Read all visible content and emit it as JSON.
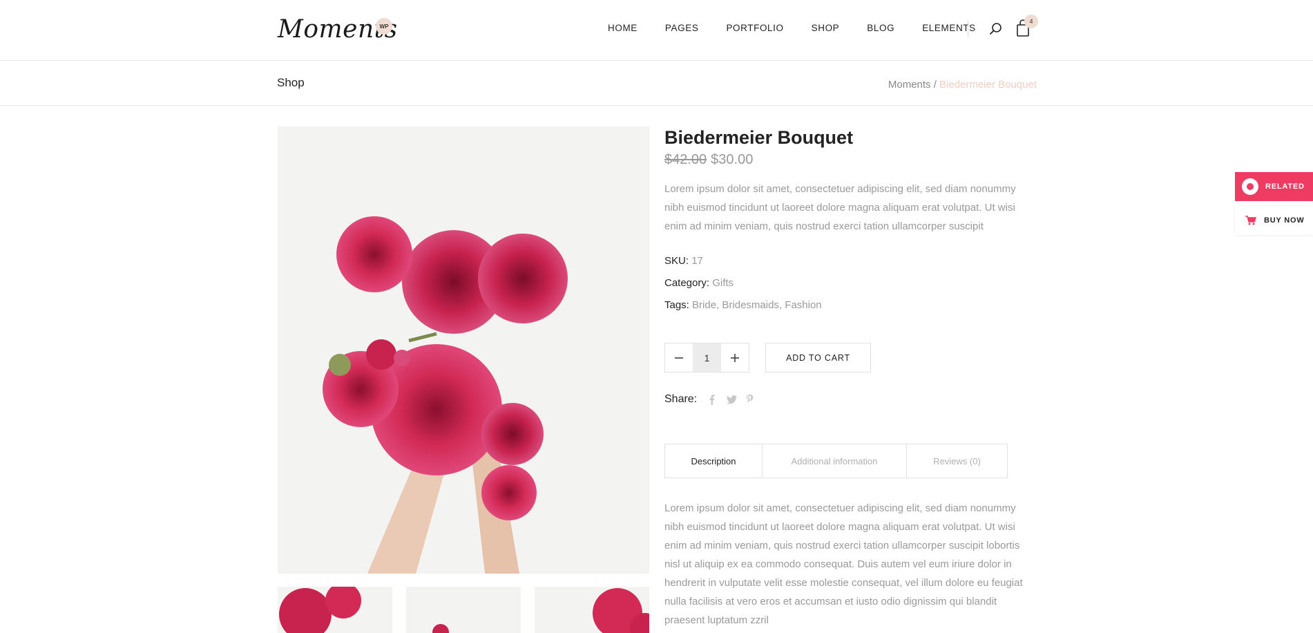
{
  "header": {
    "logo_text": "Moments",
    "logo_badge": "WP",
    "nav": [
      "HOME",
      "PAGES",
      "PORTFOLIO",
      "SHOP",
      "BLOG",
      "ELEMENTS"
    ],
    "cart_count": "4",
    "icons": {
      "search": "search-icon",
      "cart": "shopping-bag-icon"
    }
  },
  "titlebar": {
    "title": "Shop",
    "breadcrumb": {
      "home": "Moments",
      "separator": " / ",
      "current": "Biedermeier Bouquet"
    }
  },
  "product": {
    "title": "Biedermeier Bouquet",
    "old_price": "$42.00",
    "new_price": "$30.00",
    "short_description": "Lorem ipsum dolor sit amet, consectetuer adipiscing elit, sed diam nonummy nibh euismod tincidunt ut laoreet dolore magna aliquam erat volutpat. Ut wisi enim ad minim veniam, quis nostrud exerci tation ullamcorper suscipit",
    "sku_label": "SKU:",
    "sku": "17",
    "category_label": "Category:",
    "category": "Gifts",
    "tags_label": "Tags:",
    "tags": [
      "Bride",
      "Bridesmaids",
      "Fashion"
    ],
    "quantity": "1",
    "add_to_cart": "ADD TO CART",
    "share_label": "Share:",
    "share_icons": [
      "facebook-icon",
      "twitter-icon",
      "pinterest-icon"
    ]
  },
  "tabs": [
    {
      "label": "Description",
      "active": true
    },
    {
      "label": "Additional information",
      "active": false
    },
    {
      "label": "Reviews (0)",
      "active": false
    }
  ],
  "description": "Lorem ipsum dolor sit amet, consectetuer adipiscing elit, sed diam nonummy nibh euismod tincidunt ut laoreet dolore magna aliquam erat volutpat. Ut wisi enim ad minim veniam, quis nostrud exerci tation ullamcorper suscipit lobortis nisl ut aliquip ex ea commodo consequat. Duis autem vel eum iriure dolor in hendrerit in vulputate velit esse molestie consequat, vel illum dolore eu feugiat nulla facilisis at vero eros et accumsan et iusto odio dignissim qui blandit praesent luptatum zzril",
  "side_widget": {
    "related": "RELATED",
    "buy_now": "BUY NOW"
  },
  "colors": {
    "accent": "#ef3a62",
    "badge": "#f1dcd1",
    "muted_text": "#9a9a9a",
    "breadcrumb_current": "#f0cfc0"
  }
}
